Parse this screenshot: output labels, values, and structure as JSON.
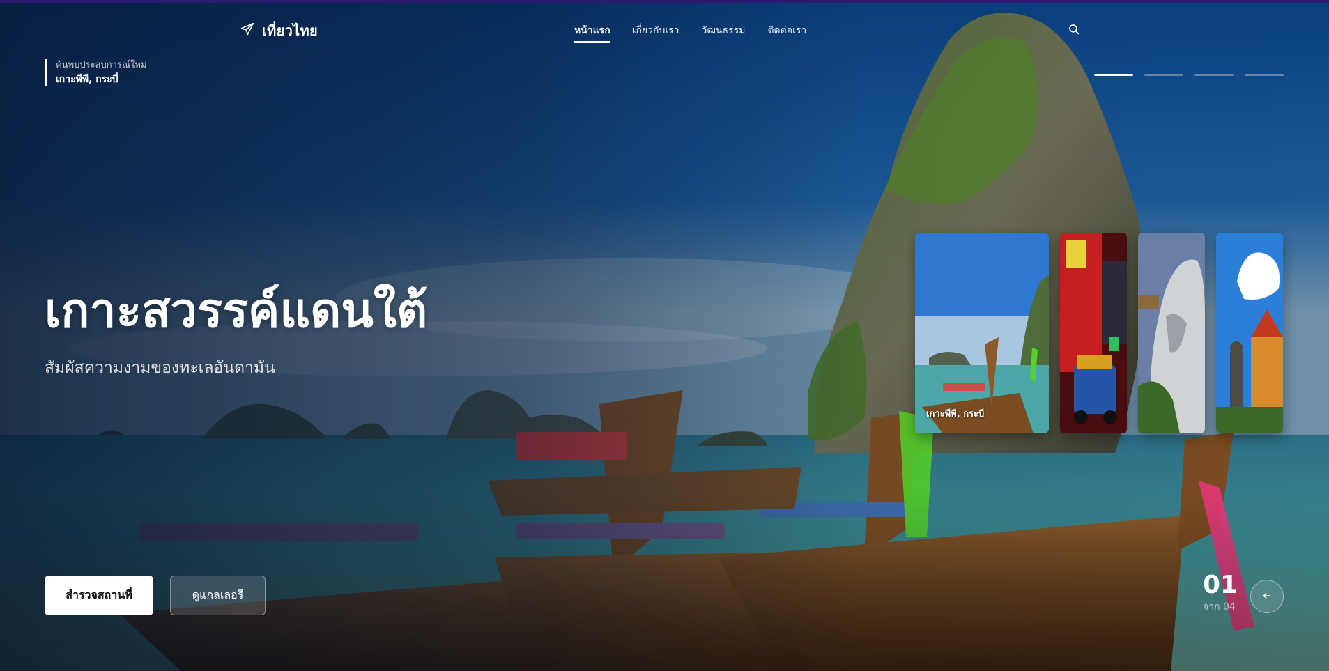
{
  "brand": {
    "name": "เที่ยวไทย",
    "icon": "airplane-icon"
  },
  "nav": {
    "items": [
      {
        "label": "หน้าแรก",
        "active": true
      },
      {
        "label": "เกี่ยวกับเรา",
        "active": false
      },
      {
        "label": "วัฒนธรรม",
        "active": false
      },
      {
        "label": "ติดต่อเรา",
        "active": false
      }
    ],
    "search_icon": "search-icon"
  },
  "location": {
    "label": "ค้นพบประสบการณ์ใหม่",
    "name": "เกาะพีพี, กระบี่"
  },
  "slides_progress": {
    "total": 4,
    "active_index": 0
  },
  "hero": {
    "title": "เกาะสวรรค์แดนใต้",
    "subtitle": "สัมผัสความงามของทะเลอันดามัน"
  },
  "buttons": {
    "primary": "สำรวจสถานที่",
    "secondary": "ดูแกลเลอรี"
  },
  "cards": [
    {
      "caption": "เกาะพีพี, กระบี่",
      "active": true
    },
    {
      "caption": "",
      "active": false
    },
    {
      "caption": "",
      "active": false
    },
    {
      "caption": "",
      "active": false
    }
  ],
  "counter": {
    "current": "01",
    "total": "จาก 04"
  },
  "arrow_icon": "arrow-left-icon",
  "colors": {
    "accent": "#ffffff",
    "sky": "#0d4a8a",
    "sea": "#3f8f95",
    "cliff": "#3b5a2a"
  }
}
